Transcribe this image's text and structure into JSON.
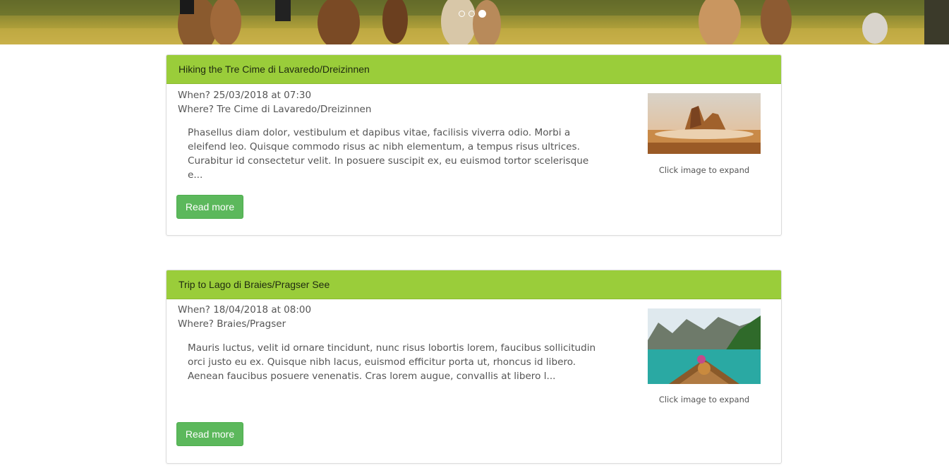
{
  "carousel": {
    "total_slides": 3,
    "active_slide": 3
  },
  "colors": {
    "card_header": "#9acd3a",
    "button": "#5cb85c"
  },
  "events": [
    {
      "title": "Hiking the Tre Cime di Lavaredo/Dreizinnen",
      "when": "When? 25/03/2018 at 07:30",
      "where": "Where? Tre Cime di Lavaredo/Dreizinnen",
      "description": "Phasellus diam dolor, vestibulum et dapibus vitae, facilisis viverra odio. Morbi a eleifend leo. Quisque commodo risus ac nibh elementum, a tempus risus ultrices. Curabitur id consectetur velit. In posuere suscipit ex, eu euismod tortor scelerisque e...",
      "image_caption": "Click image to expand",
      "button_label": "Read more"
    },
    {
      "title": "Trip to Lago di Braies/Pragser See",
      "when": "When? 18/04/2018 at 08:00",
      "where": "Where? Braies/Pragser",
      "description": "Mauris luctus, velit id ornare tincidunt, nunc risus lobortis lorem, faucibus sollicitudin orci justo eu ex. Quisque nibh lacus, euismod efficitur porta ut, rhoncus id libero. Aenean faucibus posuere venenatis. Cras lorem augue, convallis at libero l...",
      "image_caption": "Click image to expand",
      "button_label": "Read more"
    }
  ]
}
